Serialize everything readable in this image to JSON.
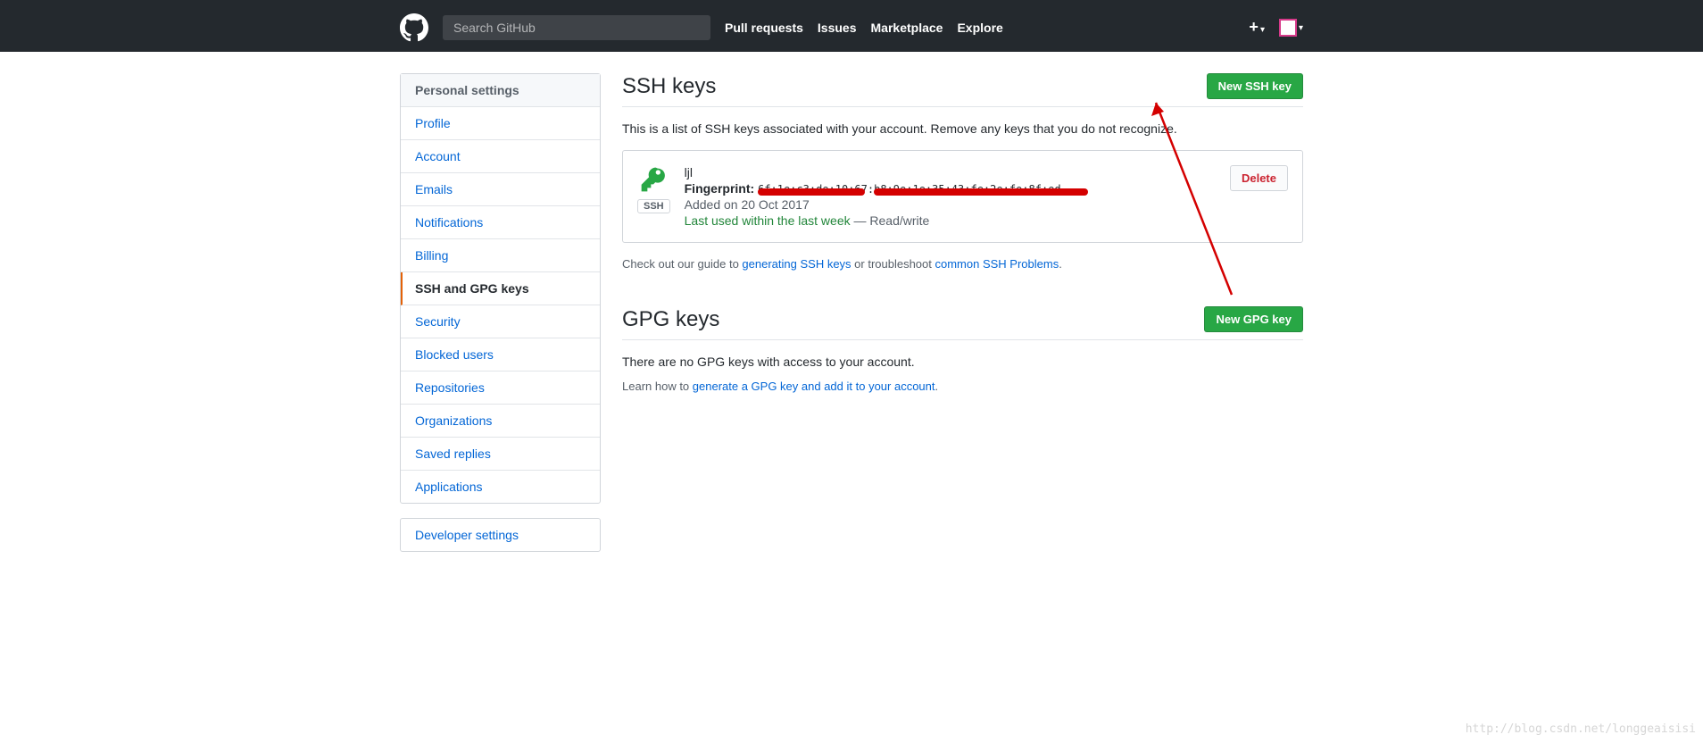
{
  "header": {
    "search_placeholder": "Search GitHub",
    "nav": [
      "Pull requests",
      "Issues",
      "Marketplace",
      "Explore"
    ]
  },
  "sidebar": {
    "heading": "Personal settings",
    "items": [
      "Profile",
      "Account",
      "Emails",
      "Notifications",
      "Billing",
      "SSH and GPG keys",
      "Security",
      "Blocked users",
      "Repositories",
      "Organizations",
      "Saved replies",
      "Applications"
    ],
    "selected_index": 5,
    "secondary": "Developer settings"
  },
  "ssh": {
    "heading": "SSH keys",
    "new_button": "New SSH key",
    "description": "This is a list of SSH keys associated with your account. Remove any keys that you do not recognize.",
    "key": {
      "title": "ljl",
      "fp_label": "Fingerprint:",
      "fp_value": "6f:1e:c3:de:10:67:b8:9e:1e:35:43:fe:2e:fe:8f:ed",
      "badge": "SSH",
      "added": "Added on 20 Oct 2017",
      "last_used": "Last used within the last week",
      "rw": " — Read/write",
      "delete": "Delete"
    },
    "guide_prefix": "Check out our guide to ",
    "guide_link1": "generating SSH keys",
    "guide_mid": " or troubleshoot ",
    "guide_link2": "common SSH Problems",
    "guide_suffix": "."
  },
  "gpg": {
    "heading": "GPG keys",
    "new_button": "New GPG key",
    "empty": "There are no GPG keys with access to your account.",
    "learn_prefix": "Learn how to ",
    "learn_link": "generate a GPG key and add it to your account",
    "learn_suffix": "."
  },
  "watermark": "http://blog.csdn.net/longgeaisisi"
}
